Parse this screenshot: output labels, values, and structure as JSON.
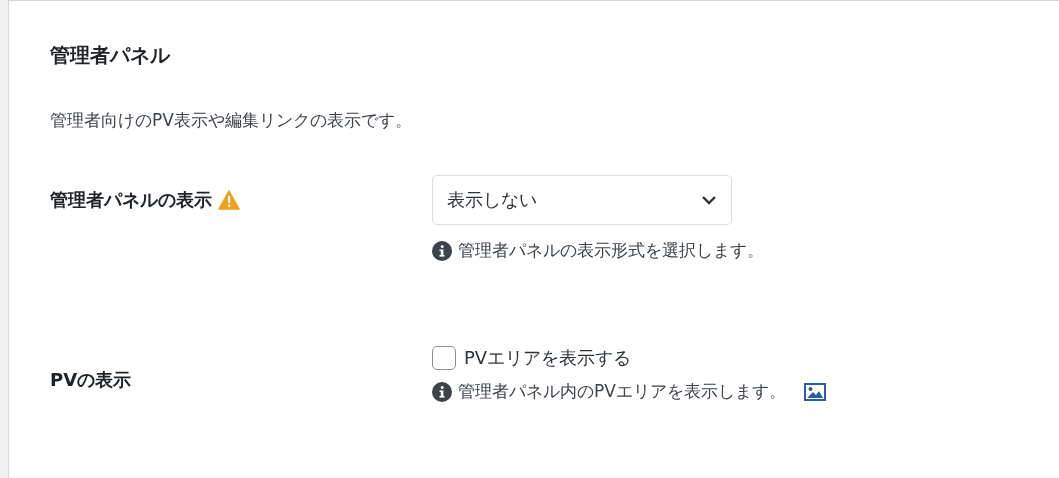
{
  "panel": {
    "title": "管理者パネル",
    "description": "管理者向けのPV表示や編集リンクの表示です。"
  },
  "settings": [
    {
      "kind": "select",
      "label": "管理者パネルの表示",
      "warning": true,
      "value": "表示しない",
      "help": "管理者パネルの表示形式を選択します。",
      "image_link": false
    },
    {
      "kind": "checkbox",
      "label": "PVの表示",
      "warning": false,
      "option": "PVエリアを表示する",
      "checked": false,
      "help": "管理者パネル内のPVエリアを表示します。",
      "image_link": true
    }
  ]
}
